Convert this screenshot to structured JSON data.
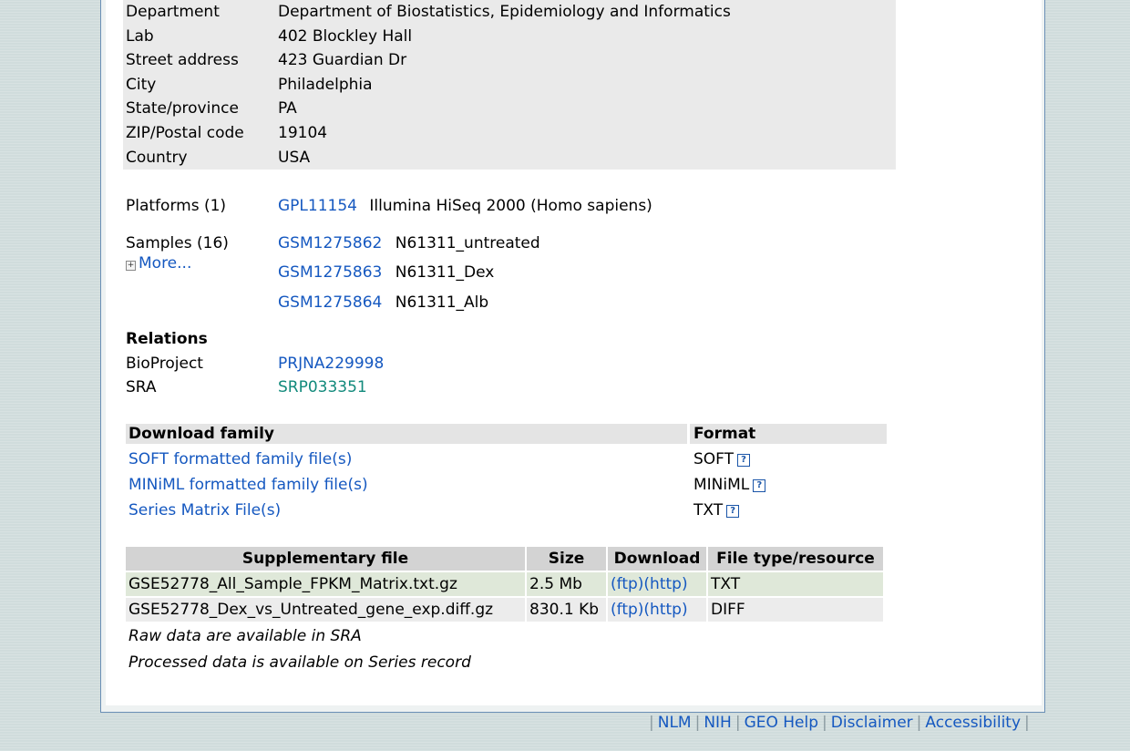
{
  "contact": {
    "rows": [
      {
        "label": "Department",
        "value": "Department of Biostatistics, Epidemiology and Informatics"
      },
      {
        "label": "Lab",
        "value": "402 Blockley Hall"
      },
      {
        "label": "Street address",
        "value": "423 Guardian Dr"
      },
      {
        "label": "City",
        "value": "Philadelphia"
      },
      {
        "label": "State/province",
        "value": "PA"
      },
      {
        "label": "ZIP/Postal code",
        "value": "19104"
      },
      {
        "label": "Country",
        "value": "USA"
      }
    ]
  },
  "platforms": {
    "label": "Platforms (1)",
    "items": [
      {
        "id": "GPL11154",
        "desc": "Illumina HiSeq 2000 (Homo sapiens)"
      }
    ]
  },
  "samples": {
    "label": "Samples (16)",
    "more_label": "More...",
    "items": [
      {
        "id": "GSM1275862",
        "desc": "N61311_untreated"
      },
      {
        "id": "GSM1275863",
        "desc": "N61311_Dex"
      },
      {
        "id": "GSM1275864",
        "desc": "N61311_Alb"
      }
    ]
  },
  "relations": {
    "heading": "Relations",
    "rows": [
      {
        "label": "BioProject",
        "value": "PRJNA229998"
      },
      {
        "label": "SRA",
        "value": "SRP033351"
      }
    ]
  },
  "download_family": {
    "header": "Download family",
    "format_header": "Format",
    "rows": [
      {
        "label": "SOFT formatted family file(s)",
        "format": "SOFT"
      },
      {
        "label": "MINiML formatted family file(s)",
        "format": "MINiML"
      },
      {
        "label": "Series Matrix File(s)",
        "format": "TXT"
      }
    ],
    "help_glyph": "?"
  },
  "supplementary": {
    "headers": [
      "Supplementary file",
      "Size",
      "Download",
      "File type/resource"
    ],
    "rows": [
      {
        "file": "GSE52778_All_Sample_FPKM_Matrix.txt.gz",
        "size": "2.5 Mb",
        "ftp": "(ftp)",
        "http": "(http)",
        "type": "TXT"
      },
      {
        "file": "GSE52778_Dex_vs_Untreated_gene_exp.diff.gz",
        "size": "830.1 Kb",
        "ftp": "(ftp)",
        "http": "(http)",
        "type": "DIFF"
      }
    ],
    "notes": [
      "Raw data are available in SRA",
      "Processed data is available on Series record"
    ]
  },
  "footer": {
    "separator": "|",
    "links": [
      "NLM",
      "NIH",
      "GEO Help",
      "Disclaimer",
      "Accessibility"
    ]
  },
  "colors": {
    "link": "#1558c0",
    "sra_link": "#128a7c",
    "background": "#d0dcdc"
  },
  "icons": {
    "expand": "plus-box-icon",
    "help": "help-question-icon"
  }
}
